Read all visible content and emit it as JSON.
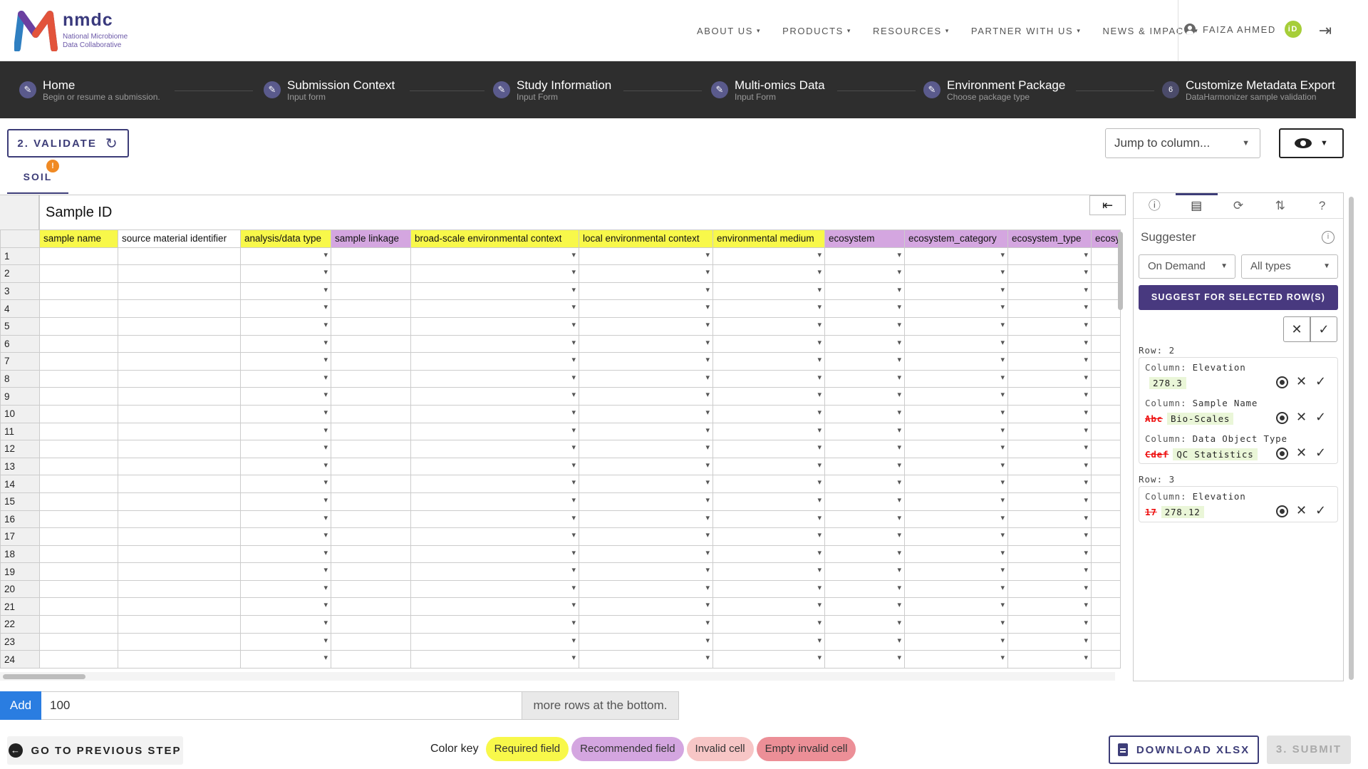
{
  "brand": {
    "name": "nmdc",
    "sub1": "National Microbiome",
    "sub2": "Data Collaborative"
  },
  "nav": [
    {
      "label": "ABOUT US"
    },
    {
      "label": "PRODUCTS"
    },
    {
      "label": "RESOURCES"
    },
    {
      "label": "PARTNER WITH US"
    },
    {
      "label": "NEWS & IMPACT"
    }
  ],
  "user": {
    "name": "FAIZA AHMED",
    "orcid": "iD"
  },
  "steps": [
    {
      "title": "Home",
      "sub": "Begin or resume a submission.",
      "marker": "✎"
    },
    {
      "title": "Submission Context",
      "sub": "Input form",
      "marker": "✎"
    },
    {
      "title": "Study Information",
      "sub": "Input Form",
      "marker": "✎"
    },
    {
      "title": "Multi-omics Data",
      "sub": "Input Form",
      "marker": "✎"
    },
    {
      "title": "Environment Package",
      "sub": "Choose package type",
      "marker": "✎"
    },
    {
      "title": "Customize Metadata Export",
      "sub": "DataHarmonizer sample validation",
      "marker": "6"
    }
  ],
  "toolbar": {
    "validate_label": "2. VALIDATE",
    "tab_label": "SOIL",
    "tab_badge": "!",
    "jump_placeholder": "Jump to column..."
  },
  "grid": {
    "section_title": "Sample ID",
    "columns": [
      {
        "label": "sample name",
        "kind": "req",
        "dropdown": false
      },
      {
        "label": "source material identifier",
        "kind": "plain",
        "dropdown": false
      },
      {
        "label": "analysis/data type",
        "kind": "req",
        "dropdown": true
      },
      {
        "label": "sample linkage",
        "kind": "rec",
        "dropdown": false
      },
      {
        "label": "broad-scale environmental context",
        "kind": "req",
        "dropdown": true
      },
      {
        "label": "local environmental context",
        "kind": "req",
        "dropdown": true
      },
      {
        "label": "environmental medium",
        "kind": "req",
        "dropdown": true
      },
      {
        "label": "ecosystem",
        "kind": "rec",
        "dropdown": true
      },
      {
        "label": "ecosystem_category",
        "kind": "rec",
        "dropdown": true
      },
      {
        "label": "ecosystem_type",
        "kind": "rec",
        "dropdown": true
      },
      {
        "label": "ecosy",
        "kind": "rec",
        "dropdown": false
      }
    ],
    "row_numbers": [
      "1",
      "2",
      "3",
      "4",
      "5",
      "6",
      "7",
      "8",
      "9",
      "10",
      "11",
      "12",
      "13",
      "14",
      "15",
      "16",
      "17",
      "18",
      "19",
      "20",
      "21",
      "22",
      "23",
      "24"
    ]
  },
  "add_rows": {
    "button": "Add",
    "value": "100",
    "suffix": "more rows at the bottom."
  },
  "suggester": {
    "tabs": [
      "info-icon",
      "comment-icon",
      "sync-icon",
      "sort-icon",
      "help-icon"
    ],
    "title": "Suggester",
    "mode": "On Demand",
    "type": "All types",
    "suggest_button": "SUGGEST FOR SELECTED ROW(S)",
    "groups": [
      {
        "row_label": "Row: 2",
        "items": [
          {
            "column": "Elevation",
            "old": "",
            "new": "278.3"
          },
          {
            "column": "Sample Name",
            "old": "Abc",
            "new": "Bio-Scales"
          },
          {
            "column": "Data Object Type",
            "old": "Cdef",
            "new": "QC Statistics"
          }
        ]
      },
      {
        "row_label": "Row: 3",
        "items": [
          {
            "column": "Elevation",
            "old": "17",
            "new": "278.12"
          }
        ]
      }
    ]
  },
  "footer": {
    "prev_label": "GO TO PREVIOUS STEP",
    "colorkey_label": "Color key",
    "chips": [
      {
        "label": "Required field",
        "color": "#f8f84a"
      },
      {
        "label": "Recommended field",
        "color": "#d4a6e0"
      },
      {
        "label": "Invalid cell",
        "color": "#f7c6c6"
      },
      {
        "label": "Empty invalid cell",
        "color": "#ec8f97"
      }
    ],
    "download_label": "DOWNLOAD XLSX",
    "submit_label": "3. SUBMIT"
  },
  "colors": {
    "accent": "#3d3d78",
    "suggest": "#48397f",
    "add": "#2a7de1"
  }
}
